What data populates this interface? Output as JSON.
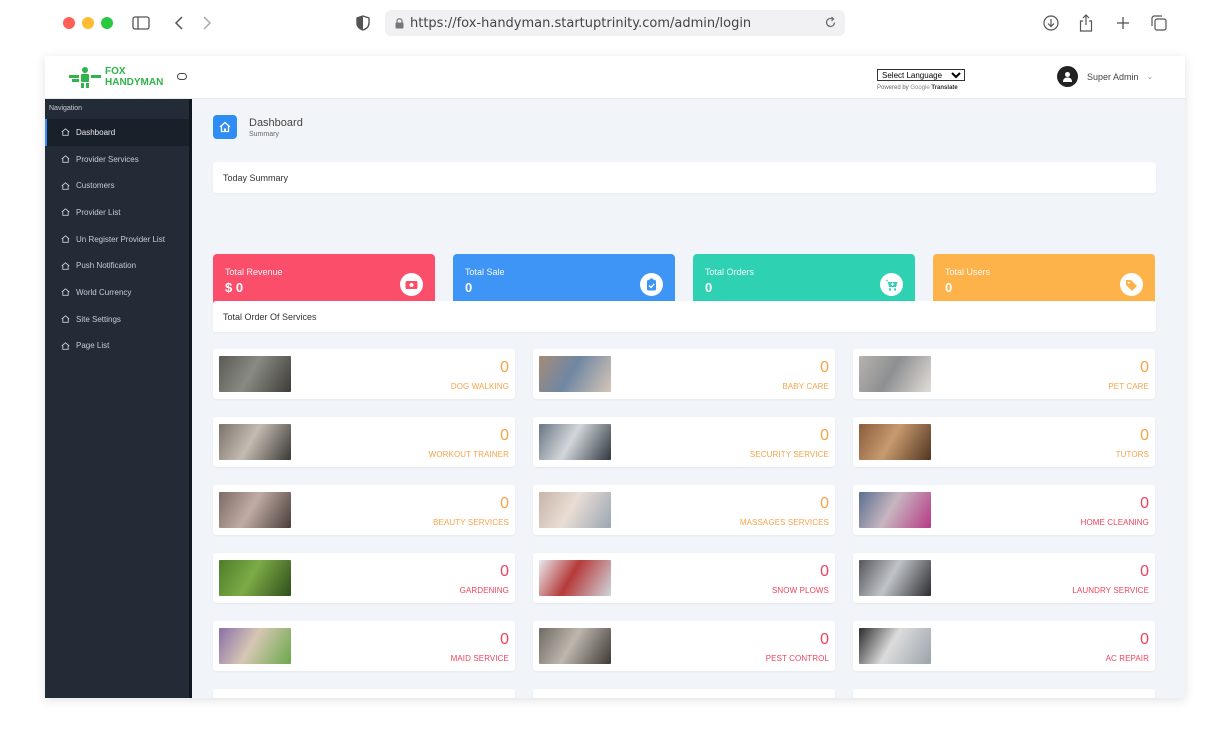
{
  "browser": {
    "url": "https://fox-handyman.startuptrinity.com/admin/login",
    "traffic_colors": [
      "#ff5f57",
      "#febc2e",
      "#28c840"
    ]
  },
  "header": {
    "logo_line1": "FOX",
    "logo_line2": "HANDYMAN",
    "language_select": "Select Language",
    "powered_by": "Powered by",
    "google": "Google",
    "translate": "Translate",
    "user_name": "Super Admin"
  },
  "sidebar": {
    "heading": "Navigation",
    "items": [
      {
        "label": "Dashboard",
        "active": true
      },
      {
        "label": "Provider Services"
      },
      {
        "label": "Customers"
      },
      {
        "label": "Provider List"
      },
      {
        "label": "Un Register Provider List"
      },
      {
        "label": "Push Notification"
      },
      {
        "label": "World Currency"
      },
      {
        "label": "Site Settings"
      },
      {
        "label": "Page List"
      }
    ]
  },
  "page": {
    "title": "Dashboard",
    "subtitle": "Summary",
    "today_summary": "Today Summary",
    "total_order_services": "Total Order Of Services"
  },
  "stats": [
    {
      "label": "Total Revenue",
      "value": "$ 0",
      "color": "#fb4e6a",
      "icon": "money-icon"
    },
    {
      "label": "Total Sale",
      "value": "0",
      "color": "#3e95f5",
      "icon": "clipboard-check-icon"
    },
    {
      "label": "Total Orders",
      "value": "0",
      "color": "#2fd1b3",
      "icon": "cart-icon"
    },
    {
      "label": "Total Users",
      "value": "0",
      "color": "#fdb24a",
      "icon": "tag-icon"
    }
  ],
  "services": [
    {
      "name": "DOG WALKING",
      "count": "0",
      "color": "orange"
    },
    {
      "name": "BABY CARE",
      "count": "0",
      "color": "orange"
    },
    {
      "name": "PET CARE",
      "count": "0",
      "color": "orange"
    },
    {
      "name": "WORKOUT TRAINER",
      "count": "0",
      "color": "orange"
    },
    {
      "name": "SECURITY SERVICE",
      "count": "0",
      "color": "orange"
    },
    {
      "name": "TUTORS",
      "count": "0",
      "color": "orange"
    },
    {
      "name": "BEAUTY SERVICES",
      "count": "0",
      "color": "orange"
    },
    {
      "name": "MASSAGES SERVICES",
      "count": "0",
      "color": "orange"
    },
    {
      "name": "HOME CLEANING",
      "count": "0",
      "color": "red"
    },
    {
      "name": "GARDENING",
      "count": "0",
      "color": "red"
    },
    {
      "name": "SNOW PLOWS",
      "count": "0",
      "color": "red"
    },
    {
      "name": "LAUNDRY SERVICE",
      "count": "0",
      "color": "red"
    },
    {
      "name": "MAID SERVICE",
      "count": "0",
      "color": "red"
    },
    {
      "name": "PEST CONTROL",
      "count": "0",
      "color": "red"
    },
    {
      "name": "AC REPAIR",
      "count": "0",
      "color": "red"
    }
  ]
}
